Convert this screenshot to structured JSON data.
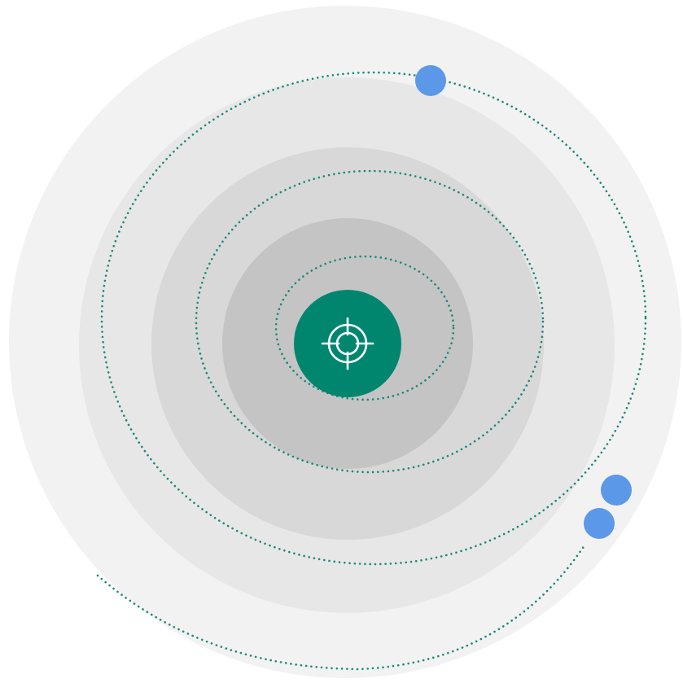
{
  "colors": {
    "background": "#ffffff",
    "ring_outer": "#f2f2f2",
    "ring_2": "#e7e7e7",
    "ring_3": "#d8d8d8",
    "ring_inner": "#c4c4c4",
    "center": "#00866f",
    "orbit": "#1a8a78",
    "satellite": "#5b99e8",
    "icon": "#ffffff"
  },
  "center_icon": "crosshair-target-icon",
  "satellite_icon": "blue-dot",
  "rings": [
    {
      "name": "ring-outer"
    },
    {
      "name": "ring-2"
    },
    {
      "name": "ring-3"
    },
    {
      "name": "ring-inner"
    }
  ],
  "orbits": [
    {
      "name": "orbit-inner"
    },
    {
      "name": "orbit-middle"
    },
    {
      "name": "orbit-outer"
    },
    {
      "name": "orbit-large"
    }
  ],
  "satellites": [
    {
      "name": "satellite-top"
    },
    {
      "name": "satellite-right-upper"
    },
    {
      "name": "satellite-right-lower"
    }
  ]
}
